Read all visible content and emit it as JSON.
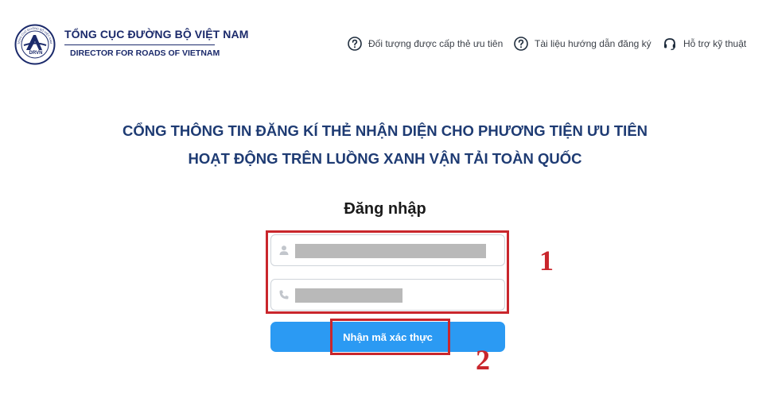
{
  "brand": {
    "title": "TỔNG CỤC ĐƯỜNG BỘ VIỆT NAM",
    "subtitle": "DIRECTOR FOR ROADS OF VIETNAM",
    "logo_text": "DRVN",
    "logo_ring_text": "TỔNG CỤC ĐƯỜNG BỘ VIỆT NAM"
  },
  "nav": [
    {
      "label": "Đối tượng được cấp thẻ ưu tiên",
      "icon": "question-circle-icon"
    },
    {
      "label": "Tài liệu hướng dẫn đăng ký",
      "icon": "question-circle-icon"
    },
    {
      "label": "Hỗ trợ kỹ thuật",
      "icon": "headset-icon"
    }
  ],
  "headline": {
    "line1": "CỔNG THÔNG TIN ĐĂNG KÍ THẺ NHẬN DIỆN CHO PHƯƠNG TIỆN ƯU TIÊN",
    "line2": "HOẠT ĐỘNG TRÊN LUỒNG XANH VẬN TẢI TOÀN QUỐC"
  },
  "login": {
    "title": "Đăng nhập",
    "name_field": {
      "value": "",
      "placeholder": "",
      "icon": "user-icon"
    },
    "phone_field": {
      "value": "",
      "placeholder": "",
      "icon": "phone-icon"
    },
    "submit_label": "Nhận mã xác thực"
  },
  "annotations": {
    "step1": "1",
    "step2": "2"
  },
  "colors": {
    "brand_navy": "#1b2a6b",
    "headline": "#1e3b73",
    "button": "#2b9af3",
    "highlight": "#c9262c"
  }
}
